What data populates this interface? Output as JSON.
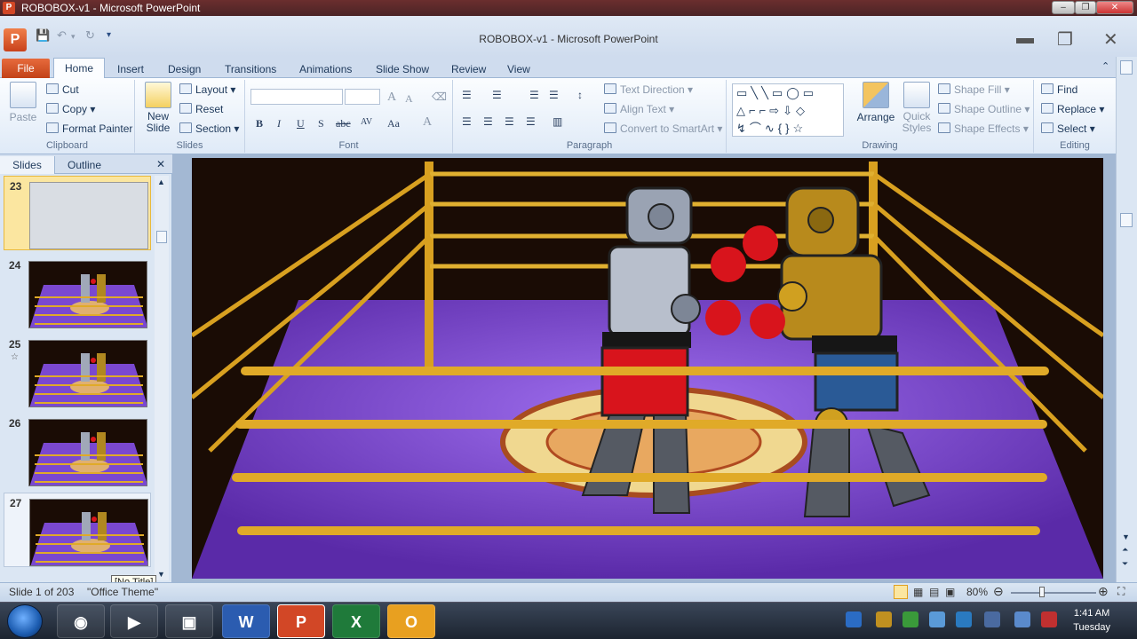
{
  "window": {
    "titlebar": "ROBOBOX-v1 - Microsoft PowerPoint",
    "doc_title": "ROBOBOX-v1  -  Microsoft PowerPoint",
    "app_icon": "P"
  },
  "tabs": [
    "File",
    "Home",
    "Insert",
    "Design",
    "Transitions",
    "Animations",
    "Slide Show",
    "Review",
    "View"
  ],
  "ribbon": {
    "clipboard": {
      "paste": "Paste",
      "cut": "Cut",
      "copy": "Copy",
      "format_painter": "Format Painter",
      "name": "Clipboard"
    },
    "slides": {
      "new_slide": "New Slide",
      "layout": "Layout",
      "reset": "Reset",
      "section": "Section",
      "name": "Slides"
    },
    "font": {
      "name": "Font",
      "bold": "B",
      "italic": "I",
      "underline": "U",
      "shadow": "S",
      "strike": "abc",
      "spacing": "AV",
      "case": "Aa",
      "color": "A"
    },
    "paragraph": {
      "name": "Paragraph",
      "text_direction": "Text Direction",
      "align_text": "Align Text",
      "convert_smartart": "Convert to SmartArt"
    },
    "drawing": {
      "name": "Drawing",
      "arrange": "Arrange",
      "quick_styles": "Quick Styles",
      "shape_fill": "Shape Fill",
      "shape_outline": "Shape Outline",
      "shape_effects": "Shape Effects"
    },
    "editing": {
      "name": "Editing",
      "find": "Find",
      "replace": "Replace",
      "select": "Select"
    }
  },
  "panel": {
    "tab_slides": "Slides",
    "tab_outline": "Outline",
    "thumbnails": [
      {
        "num": "23"
      },
      {
        "num": "24"
      },
      {
        "num": "25"
      },
      {
        "num": "26"
      },
      {
        "num": "27"
      }
    ]
  },
  "tooltip": "[No Title]",
  "status": {
    "slide_info": "Slide 1 of 203",
    "theme": "\"Office Theme\"",
    "zoom": "80%"
  },
  "taskbar": {
    "apps": [
      {
        "letter": "W",
        "color": "#2b5cb0"
      },
      {
        "letter": "P",
        "color": "#d24726"
      },
      {
        "letter": "X",
        "color": "#1f7a3a"
      },
      {
        "letter": "O",
        "color": "#e8a020"
      }
    ],
    "time": "1:41 AM",
    "day": "Tuesday"
  }
}
